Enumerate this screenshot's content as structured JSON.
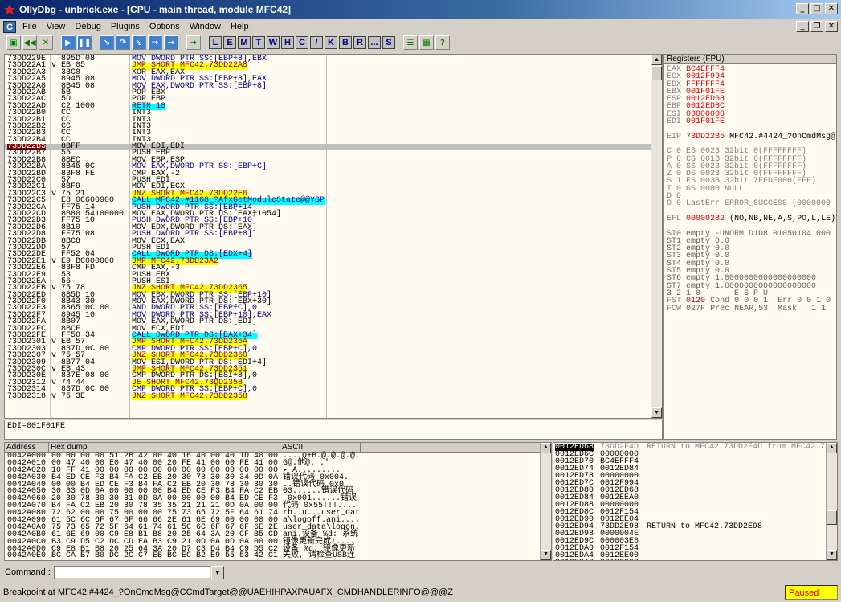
{
  "window": {
    "title": "OllyDbg - unbrick.exe - [CPU - main thread, module MFC42]",
    "min": "_",
    "max": "□",
    "close": "✕"
  },
  "menu": {
    "app_icon": "C",
    "items": [
      "File",
      "View",
      "Debug",
      "Plugins",
      "Options",
      "Window",
      "Help"
    ]
  },
  "toolbar": {
    "icons": [
      "open-icon",
      "restart-icon",
      "close-icon",
      "run-icon",
      "pause-icon",
      "step-into-icon",
      "step-over-icon",
      "trace-into-icon",
      "trace-over-icon",
      "execute-till-return-icon",
      "goto-icon"
    ],
    "letters": [
      "L",
      "E",
      "M",
      "T",
      "W",
      "H",
      "C",
      "/",
      "K",
      "B",
      "R",
      "...",
      "S"
    ],
    "extra": [
      "list-icon",
      "grid-icon",
      "help-icon"
    ]
  },
  "cpu": {
    "rows": [
      [
        "73DD229E",
        "",
        "895D 08",
        "MOV DWORD PTR SS:[EBP+8],EBX",
        "c"
      ],
      [
        "73DD22A1",
        "v",
        "EB 05",
        "JMP SHORT MFC42.73DD22A8",
        "y"
      ],
      [
        "73DD22A3",
        "",
        "33C0",
        "XOR EAX,EAX",
        ""
      ],
      [
        "73DD22A5",
        "",
        "8945 08",
        "MOV DWORD PTR SS:[EBP+8],EAX",
        "c"
      ],
      [
        "73DD22A8",
        "",
        "8B45 08",
        "MOV EAX,DWORD PTR SS:[EBP+8]",
        "c"
      ],
      [
        "73DD22AB",
        "",
        "5B",
        "POP EBX",
        ""
      ],
      [
        "73DD22AC",
        "",
        "5D",
        "POP EBP",
        ""
      ],
      [
        "73DD22AD",
        "",
        "C2 1000",
        "RETN 10",
        "cc"
      ],
      [
        "73DD22B0",
        "",
        "CC",
        "INT3",
        ""
      ],
      [
        "73DD22B1",
        "",
        "CC",
        "INT3",
        ""
      ],
      [
        "73DD22B2",
        "",
        "CC",
        "INT3",
        ""
      ],
      [
        "73DD22B3",
        "",
        "CC",
        "INT3",
        ""
      ],
      [
        "73DD22B4",
        "",
        "CC",
        "INT3",
        ""
      ],
      [
        "73DD22B5",
        "",
        "8BFF",
        "MOV EDI,EDI",
        "sel"
      ],
      [
        "73DD22B7",
        "",
        "55",
        "PUSH EBP",
        ""
      ],
      [
        "73DD22B8",
        "",
        "8BEC",
        "MOV EBP,ESP",
        ""
      ],
      [
        "73DD22BA",
        "",
        "8B45 0C",
        "MOV EAX,DWORD PTR SS:[EBP+C]",
        "c"
      ],
      [
        "73DD22BD",
        "",
        "83F8 FE",
        "CMP EAX,-2",
        ""
      ],
      [
        "73DD22C0",
        "",
        "57",
        "PUSH EDI",
        ""
      ],
      [
        "73DD22C1",
        "",
        "8BF9",
        "MOV EDI,ECX",
        ""
      ],
      [
        "73DD22C3",
        "v",
        "75 21",
        "JNZ SHORT MFC42.73DD22E6",
        "y"
      ],
      [
        "73DD22C5",
        "",
        "E8 0C600900",
        "CALL MFC42.#1168_?AfxGetModuleState@@YGP",
        "cc"
      ],
      [
        "73DD22CA",
        "",
        "FF75 14",
        "PUSH DWORD PTR SS:[EBP+14]",
        "c"
      ],
      [
        "73DD22CD",
        "",
        "8B80 54100000",
        "MOV EAX,DWORD PTR DS:[EAX+1054]",
        ""
      ],
      [
        "73DD22D3",
        "",
        "FF75 10",
        "PUSH DWORD PTR SS:[EBP+10]",
        "c"
      ],
      [
        "73DD22D6",
        "",
        "8B10",
        "MOV EDX,DWORD PTR DS:[EAX]",
        ""
      ],
      [
        "73DD22D8",
        "",
        "FF75 08",
        "PUSH DWORD PTR SS:[EBP+8]",
        "c"
      ],
      [
        "73DD22DB",
        "",
        "8BC8",
        "MOV ECX,EAX",
        ""
      ],
      [
        "73DD22DD",
        "",
        "57",
        "PUSH EDI",
        ""
      ],
      [
        "73DD22DE",
        "",
        "FF52 04",
        "CALL DWORD PTR DS:[EDX+4]",
        "cc"
      ],
      [
        "73DD22E1",
        "v",
        "E9 BC000000",
        "JMP MFC42.73DD23A2",
        "y"
      ],
      [
        "73DD22E6",
        "",
        "83F8 FD",
        "CMP EAX,-3",
        ""
      ],
      [
        "73DD22E9",
        "",
        "53",
        "PUSH EBX",
        ""
      ],
      [
        "73DD22EA",
        "",
        "56",
        "PUSH ESI",
        ""
      ],
      [
        "73DD22EB",
        "v",
        "75 78",
        "JNZ SHORT MFC42.73DD2365",
        "y"
      ],
      [
        "73DD22ED",
        "",
        "8B5D 10",
        "MOV EBX,DWORD PTR SS:[EBP+10]",
        "c"
      ],
      [
        "73DD22F0",
        "",
        "8B43 30",
        "MOV EAX,DWORD PTR DS:[EBX+30]",
        ""
      ],
      [
        "73DD22F3",
        "",
        "8365 0C 00",
        "AND DWORD PTR SS:[EBP+C],0",
        "c"
      ],
      [
        "73DD22F7",
        "",
        "8945 10",
        "MOV DWORD PTR SS:[EBP+10],EAX",
        "c"
      ],
      [
        "73DD22FA",
        "",
        "8B07",
        "MOV EAX,DWORD PTR DS:[EDI]",
        ""
      ],
      [
        "73DD22FC",
        "",
        "8BCF",
        "MOV ECX,EDI",
        ""
      ],
      [
        "73DD22FE",
        "",
        "FF50 34",
        "CALL DWORD PTR DS:[EAX+34]",
        "cc"
      ],
      [
        "73DD2301",
        "v",
        "EB 57",
        "JMP SHORT MFC42.73DD235A",
        "y"
      ],
      [
        "73DD2303",
        "",
        "837D 0C 00",
        "CMP DWORD PTR SS:[EBP+C],0",
        "c"
      ],
      [
        "73DD2307",
        "v",
        "75 57",
        "JNZ SHORT MFC42.73DD2360",
        "y"
      ],
      [
        "73DD2309",
        "",
        "8B77 04",
        "MOV ESI,DWORD PTR DS:[EDI+4]",
        ""
      ],
      [
        "73DD230C",
        "v",
        "EB 43",
        "JMP SHORT MFC42.73DD2351",
        "y"
      ],
      [
        "73DD230E",
        "",
        "837E 08 00",
        "CMP DWORD PTR DS:[ESI+8],0",
        ""
      ],
      [
        "73DD2312",
        "v",
        "74 44",
        "JE SHORT MFC42.73DD2358",
        "y"
      ],
      [
        "73DD2314",
        "",
        "837D 0C 00",
        "CMP DWORD PTR SS:[EBP+C],0",
        "c"
      ],
      [
        "73DD2318",
        "v",
        "75 3E",
        "JNZ SHORT MFC42.73DD2358",
        "y"
      ]
    ]
  },
  "info": "EDI=001F01FE",
  "registers": {
    "header": "Registers (FPU)",
    "gp": [
      [
        "EAX",
        "BC4EFFF4"
      ],
      [
        "ECX",
        "0012F994"
      ],
      [
        "EDX",
        "FFFFFFF4"
      ],
      [
        "EBX",
        "001F01FE"
      ],
      [
        "ESP",
        "0012ED68"
      ],
      [
        "EBP",
        "0012ED8C"
      ],
      [
        "ESI",
        "00000000"
      ],
      [
        "EDI",
        "001F01FE"
      ]
    ],
    "eip": [
      "EIP",
      "73DD22B5",
      "MFC42.#4424_?OnCmdMsg@"
    ],
    "flags": [
      [
        "C 0",
        "ES 0023 32bit 0(FFFFFFFF)"
      ],
      [
        "P 0",
        "CS 001B 32bit 0(FFFFFFFF)"
      ],
      [
        "A 0",
        "SS 0023 32bit 0(FFFFFFFF)"
      ],
      [
        "Z 0",
        "DS 0023 32bit 0(FFFFFFFF)"
      ],
      [
        "S 1",
        "FS 003B 32bit 7FFDF000(FFF)"
      ],
      [
        "T 0",
        "GS 0000 NULL"
      ],
      [
        "D 0",
        ""
      ],
      [
        "O 0",
        "LastErr ERROR_SUCCESS (0000000"
      ]
    ],
    "efl": [
      "EFL",
      "00000282",
      "(NO,NB,NE,A,S,PO,L,LE)"
    ],
    "fpu": [
      "ST0 empty -UNORM D1D8 01050104 000",
      "ST1 empty 0.0",
      "ST2 empty 0.0",
      "ST3 empty 0.0",
      "ST4 empty 0.0",
      "ST5 empty 0.0",
      "ST6 empty 1.0000000000000000000",
      "ST7 empty 1.0000000000000000000"
    ],
    "fpu_bits": "3 2 1 0       E S P U",
    "fst": [
      "FST",
      "0120",
      "Cond 0 0 0 1  Err 0 0 1 0"
    ],
    "fcw": [
      "FCW",
      "027F",
      "Prec NEAR,53  Mask   1 1"
    ]
  },
  "dump": {
    "headers": [
      "Address",
      "Hex dump",
      "ASCII"
    ],
    "rows": [
      [
        "0042A000",
        "00 00 00 00 51 2B 42 00 40 16 40 00 40 1D 40 00",
        "....Q+B.@.@.@.@."
      ],
      [
        "0042A010",
        "00 47 40 00 E0 47 40 00 20 FE 41 00 60 FE 41 00",
        "G@.他@. .'"
      ],
      [
        "0042A020",
        "10 FF 41 00 00 00 00 00 00 00 00 00 00 00 00 00",
        "▸ A........."
      ],
      [
        "0042A030",
        "B4 ED CE F3 B4 FA C2 EB 20 30 78 30 30 34 0D 0A",
        "错误代码 0x004."
      ],
      [
        "0042A040",
        "00 00 B4 ED CE F3 B4 FA C2 EB 20 30 78 30 30 30",
        "..错误代码 0x0"
      ],
      [
        "0042A050",
        "30 33 0D 0A 00 00 00 00 B4 ED CE F3 B4 FA C2 EB",
        "03......错误代码"
      ],
      [
        "0042A060",
        "20 30 78 30 30 31 0D 0A 00 00 00 00 B4 ED CE F3",
        " 0x001......错误"
      ],
      [
        "0042A070",
        "B4 FA C2 EB 20 30 78 35 35 21 21 21 0D 0A 00 00",
        "代码 0x55!!!...."
      ],
      [
        "0042A080",
        "72 62 00 00 75 00 00 00 75 73 65 72 5F 64 61 74",
        "rb..u...user_dat"
      ],
      [
        "0042A090",
        "61 5C 6C 6F 67 6F 66 66 2E 61 6E 69 00 00 00 00",
        "a\\logoff.ani...."
      ],
      [
        "0042A0A0",
        "75 73 65 72 5F 64 61 74 61 5C 6C 6F 67 6F 6E 2E",
        "user_data\\logon."
      ],
      [
        "0042A0B0",
        "61 6E 69 00 C9 E8 B1 B8 20 25 64 3A 20 CF B5 CD",
        "ani.设备 %d: 系统"
      ],
      [
        "0042A0C0",
        "B3 C9 D5 C2 DC CD EA B3 C9 21 0D 0A 0D 0A 00 00",
        "镜像更新完成!...."
      ],
      [
        "0042A0D0",
        "C9 E8 B1 B8 20 25 64 3A 20 D7 C3 D4 B4 C9 D5 C2",
        "设备 %d: 镜像更新"
      ],
      [
        "0042A0E0",
        "BC CA B7 B0 DC 2C C7 EB BC EC B2 E9 55 53 42 C1",
        "失败, 请检查USB连"
      ]
    ]
  },
  "stack": {
    "rows": [
      [
        "0012ED68",
        "73DD2F4D",
        "RETURN to MFC42.73DD2F4D from MFC42.7"
      ],
      [
        "0012ED6C",
        "00000000",
        ""
      ],
      [
        "0012ED70",
        "BC4EFFF4",
        ""
      ],
      [
        "0012ED74",
        "0012ED84",
        ""
      ],
      [
        "0012ED78",
        "00000000",
        ""
      ],
      [
        "0012ED7C",
        "0012F994",
        ""
      ],
      [
        "0012ED80",
        "0012ED68",
        ""
      ],
      [
        "0012ED84",
        "0012EEA0",
        ""
      ],
      [
        "0012ED88",
        "00000000",
        ""
      ],
      [
        "0012ED8C",
        "0012F154",
        ""
      ],
      [
        "0012ED90",
        "0012EE04",
        ""
      ],
      [
        "0012ED94",
        "73DD2E98",
        "RETURN to MFC42.73DD2E98"
      ],
      [
        "0012ED98",
        "0000004E",
        ""
      ],
      [
        "0012ED9C",
        "000003E8",
        ""
      ],
      [
        "0012EDA0",
        "0012F154",
        ""
      ],
      [
        "0012EDA4",
        "0012EE00",
        ""
      ],
      [
        "0012EDA8",
        "00A8C908",
        ""
      ],
      [
        "0012EDAC",
        "73DD2E4F",
        "RETURN to MFC42.73DD2E4F from MFC42.7"
      ]
    ]
  },
  "command": {
    "label": "Command :",
    "value": ""
  },
  "status": {
    "text": "Breakpoint at MFC42.#4424_?OnCmdMsg@CCmdTarget@@UAEHIHPAXPAUAFX_CMDHANDLERINFO@@@Z",
    "state": "Paused"
  }
}
